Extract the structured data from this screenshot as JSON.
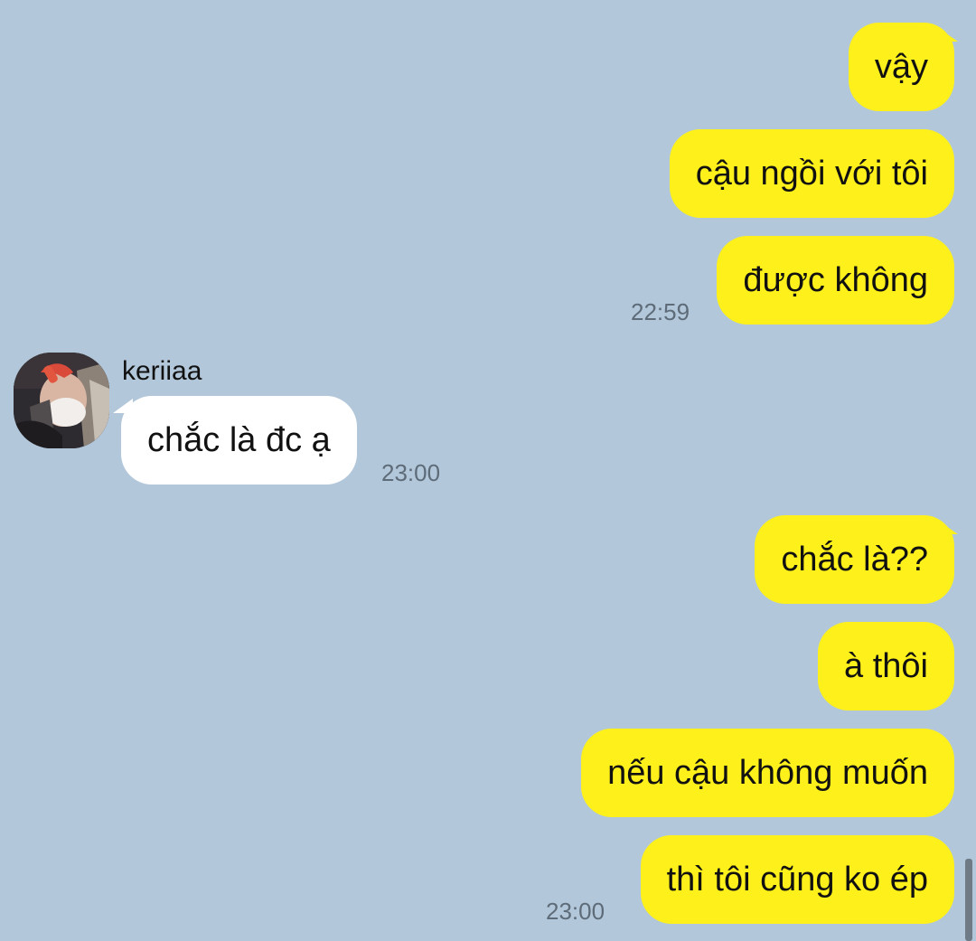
{
  "messages": [
    {
      "id": "m1",
      "direction": "outgoing",
      "text": "vậy"
    },
    {
      "id": "m2",
      "direction": "outgoing",
      "text": "cậu ngồi với tôi"
    },
    {
      "id": "m3",
      "direction": "outgoing",
      "text": "được không",
      "time": "22:59"
    },
    {
      "id": "m4",
      "direction": "incoming",
      "sender": "keriiaa",
      "text": "chắc là đc ạ",
      "time": "23:00"
    },
    {
      "id": "m5",
      "direction": "outgoing",
      "text": "chắc là??"
    },
    {
      "id": "m6",
      "direction": "outgoing",
      "text": "à thôi"
    },
    {
      "id": "m7",
      "direction": "outgoing",
      "text": "nếu cậu không muốn"
    },
    {
      "id": "m8",
      "direction": "outgoing",
      "text": "thì tôi cũng ko ép",
      "time": "23:00"
    }
  ],
  "colors": {
    "background": "#b2c7da",
    "outgoing_bubble": "#fef01b",
    "incoming_bubble": "#ffffff",
    "timestamp": "#5e6b78"
  },
  "icons": {
    "avatar": "profile-photo-avatar"
  }
}
